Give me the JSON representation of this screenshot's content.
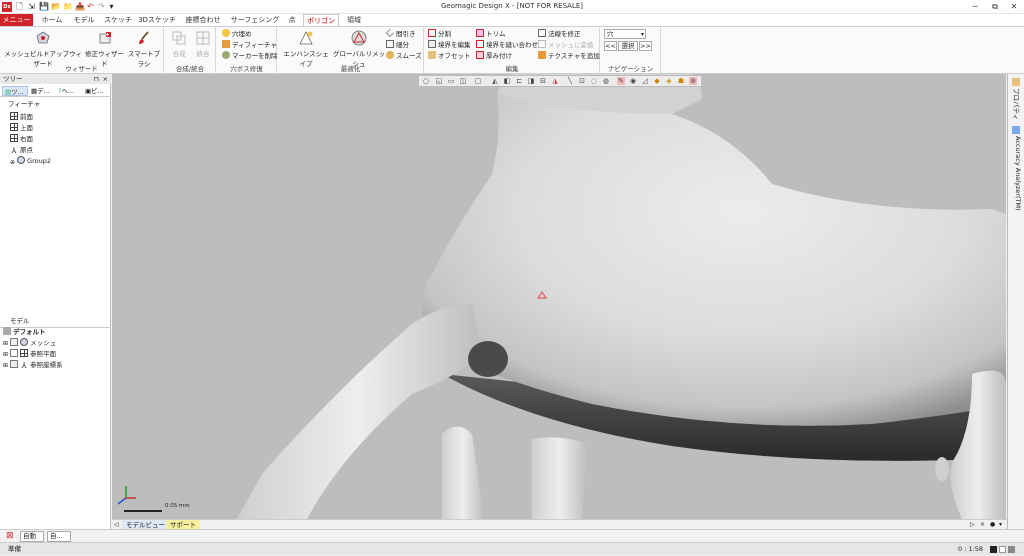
{
  "app": {
    "logo_text": "Dx",
    "title": "Geomagic Design X - [NOT FOR RESALE]"
  },
  "window_controls": {
    "minimize": "─",
    "restore": "⧉",
    "close": "✕"
  },
  "menu_tabs": [
    {
      "label": "メニュー"
    },
    {
      "label": "ホーム"
    },
    {
      "label": "モデル"
    },
    {
      "label": "スケッチ"
    },
    {
      "label": "3Dスケッチ"
    },
    {
      "label": "座標合わせ"
    },
    {
      "label": "サーフェシング"
    },
    {
      "label": "点"
    },
    {
      "label": "ポリゴン"
    },
    {
      "label": "領域"
    }
  ],
  "ribbon": {
    "wizard": {
      "label": "ウィザード",
      "buttons": [
        "メッシュビルドアップウィザード",
        "修正ウィザード",
        "スマートブラシ"
      ]
    },
    "merge": {
      "label": "合成/統合",
      "buttons": [
        "合成",
        "統合"
      ]
    },
    "hole": {
      "label": "穴ボス修復",
      "buttons": [
        "穴埋め",
        "ディフィーチャ",
        "マーカーを削除"
      ]
    },
    "optimize": {
      "label": "最適化",
      "big_buttons": [
        "エンハンスシェイプ",
        "グローバルリメッシュ"
      ],
      "small_buttons": [
        "間引き",
        "細分",
        "スムーズ"
      ]
    },
    "edit": {
      "label": "編集",
      "col1": [
        "分割",
        "境界を編集",
        "オフセット"
      ],
      "col2": [
        "トリム",
        "境界を縫い合わせ",
        "厚み付け"
      ],
      "col3": [
        "法線を修正",
        "メッシュに変換",
        "テクスチャを追加"
      ]
    },
    "navigation": {
      "label": "ナビゲーション",
      "combo_value": "穴",
      "prev": "<<",
      "select": "選択",
      "next": ">>"
    }
  },
  "tree_panel": {
    "title": "ツリー",
    "tabs": [
      "ツ...",
      "デ...",
      "ヘ...",
      "ビ..."
    ],
    "features_header": "フィーチャ",
    "features": [
      "前面",
      "上面",
      "右面",
      "原点",
      "Group2"
    ],
    "model_header": "モデル",
    "model_items": [
      "デフォルト",
      "メッシュ",
      "参照平面",
      "参照座標系"
    ]
  },
  "right_bar": {
    "tabs": [
      "プロパティ",
      "Accuracy Analyzer(TM)"
    ]
  },
  "viewport": {
    "scale_label": "0.05 mm"
  },
  "bottom_tabs": [
    "モデルビュー",
    "サポート"
  ],
  "status_row": {
    "auto1": "自動",
    "auto2": "自..."
  },
  "status": {
    "text": "準備",
    "scale": "0 : 1:58"
  },
  "colors": {
    "accent": "#d0232a",
    "support_tab": "#f6ef9b",
    "model_tab": "#dfe9f6"
  }
}
